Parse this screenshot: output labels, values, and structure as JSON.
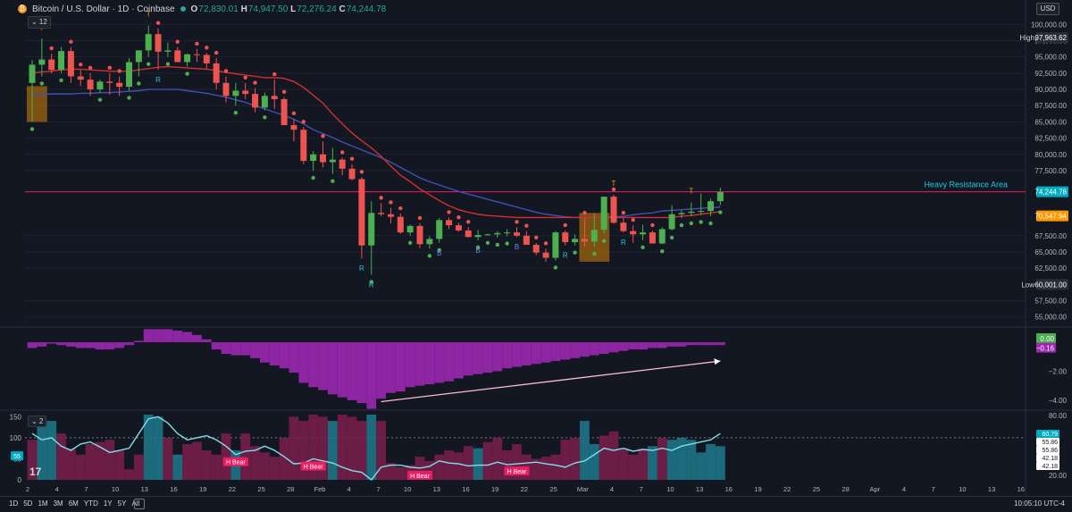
{
  "header": {
    "symbol": "Bitcoin / U.S. Dollar · 1D · Coinbase",
    "open_label": "O",
    "open": "72,830.01",
    "high_label": "H",
    "high": "74,947.50",
    "low_label": "L",
    "low": "72,276.24",
    "close_label": "C",
    "close": "74,244.78",
    "coin_glyph": "₿"
  },
  "badge_interval": "⌄ 12",
  "currency": "USD",
  "colors": {
    "bg": "#131722",
    "up": "#4caf50",
    "down": "#ef5350",
    "teal": "#26c6da",
    "orange": "#ff9800",
    "ema": "#d32f2f",
    "sma": "#3f51b5",
    "hist": "#9c27b0",
    "pink": "#e91e63",
    "grid": "#1f2330"
  },
  "chart_data": [
    {
      "type": "candlestick",
      "title": "Bitcoin / U.S. Dollar · 1D · Coinbase",
      "ylim": [
        54000,
        101000
      ],
      "y_ticks": [
        "100,000.00",
        "97,500.00",
        "95,000.00",
        "92,500.00",
        "90,000.00",
        "87,500.00",
        "85,000.00",
        "82,500.00",
        "80,000.00",
        "77,500.00",
        "67,500.00",
        "65,000.00",
        "62,500.00",
        "57,500.00",
        "55,000.00"
      ],
      "x_ticks": [
        "2",
        "4",
        "7",
        "10",
        "13",
        "16",
        "19",
        "22",
        "25",
        "28",
        "Feb",
        "4",
        "7",
        "10",
        "13",
        "16",
        "19",
        "22",
        "25",
        "Mar",
        "4",
        "7",
        "10",
        "13",
        "16",
        "19",
        "22",
        "25",
        "28",
        "Apr",
        "4",
        "7",
        "10",
        "13",
        "16"
      ],
      "candles_ohlc": [
        [
          91000,
          94500,
          85000,
          93800
        ],
        [
          93800,
          97800,
          92000,
          94600
        ],
        [
          94600,
          95500,
          92500,
          93000
        ],
        [
          93000,
          96500,
          92500,
          95900
        ],
        [
          95900,
          96500,
          91000,
          92000
        ],
        [
          92000,
          93000,
          90500,
          91500
        ],
        [
          91500,
          92500,
          89000,
          90000
        ],
        [
          90000,
          91500,
          89500,
          91200
        ],
        [
          91200,
          92500,
          89200,
          91000
        ],
        [
          91000,
          92000,
          89000,
          90400
        ],
        [
          90400,
          94800,
          89800,
          94200
        ],
        [
          94200,
          96000,
          92000,
          96000
        ],
        [
          96000,
          99800,
          95000,
          98500
        ],
        [
          98500,
          99400,
          93000,
          95800
        ],
        [
          95800,
          97200,
          95000,
          96000
        ],
        [
          96000,
          96500,
          94500,
          94200
        ],
        [
          94200,
          95500,
          93500,
          95400
        ],
        [
          95400,
          96200,
          94200,
          95300
        ],
        [
          95300,
          95600,
          93200,
          94000
        ],
        [
          94000,
          94800,
          90000,
          91000
        ],
        [
          91000,
          92000,
          88000,
          89000
        ],
        [
          89000,
          91000,
          87500,
          89800
        ],
        [
          89800,
          91000,
          88500,
          89300
        ],
        [
          89300,
          90200,
          86500,
          87200
        ],
        [
          87200,
          89500,
          86800,
          89000
        ],
        [
          89000,
          91500,
          87000,
          88500
        ],
        [
          88500,
          88800,
          84500,
          84500
        ],
        [
          84500,
          85500,
          82000,
          83800
        ],
        [
          83800,
          84200,
          78500,
          79000
        ],
        [
          79000,
          80500,
          77500,
          80000
        ],
        [
          80000,
          82000,
          78000,
          78800
        ],
        [
          78800,
          81000,
          77000,
          79200
        ],
        [
          79200,
          79500,
          76800,
          77800
        ],
        [
          77800,
          78500,
          76000,
          76200
        ],
        [
          76200,
          76500,
          64000,
          66000
        ],
        [
          66000,
          72800,
          61500,
          71000
        ],
        [
          71000,
          72500,
          70500,
          70800
        ],
        [
          70800,
          71800,
          69400,
          70400
        ],
        [
          70400,
          70900,
          67800,
          68000
        ],
        [
          68000,
          69200,
          67500,
          69000
        ],
        [
          69000,
          69400,
          65600,
          66200
        ],
        [
          66200,
          67400,
          65500,
          67000
        ],
        [
          67000,
          70200,
          66400,
          69900
        ],
        [
          69900,
          70300,
          68500,
          69100
        ],
        [
          69100,
          69500,
          68100,
          68300
        ],
        [
          68300,
          68800,
          67200,
          67300
        ],
        [
          67300,
          68400,
          66800,
          67600
        ],
        [
          67600,
          67800,
          67500,
          67700
        ],
        [
          67700,
          68200,
          67200,
          67900
        ],
        [
          67900,
          68500,
          67400,
          68000
        ],
        [
          68000,
          68800,
          67300,
          67500
        ],
        [
          67500,
          68200,
          66900,
          66100
        ],
        [
          66100,
          66400,
          64500,
          64900
        ],
        [
          64900,
          65500,
          63500,
          64100
        ],
        [
          64100,
          68200,
          63700,
          68000
        ],
        [
          68000,
          68300,
          66000,
          66500
        ],
        [
          66500,
          67700,
          66000,
          67000
        ],
        [
          67000,
          70200,
          65800,
          66600
        ],
        [
          66600,
          70900,
          65800,
          68400
        ],
        [
          68400,
          72300,
          67800,
          73500
        ],
        [
          73500,
          73800,
          69300,
          69500
        ],
        [
          69500,
          70200,
          68000,
          68200
        ],
        [
          68200,
          69100,
          66400,
          67700
        ],
        [
          67700,
          69200,
          66800,
          68000
        ],
        [
          68000,
          68300,
          66300,
          66300
        ],
        [
          66300,
          68800,
          66200,
          68500
        ],
        [
          68500,
          72200,
          68300,
          70800
        ],
        [
          70800,
          71400,
          70200,
          71000
        ],
        [
          71000,
          72600,
          70500,
          71200
        ],
        [
          71200,
          74000,
          70700,
          71300
        ],
        [
          71300,
          73200,
          70500,
          72800
        ],
        [
          72800,
          74900,
          72200,
          74200
        ]
      ],
      "ema_line": [
        92500,
        92700,
        92800,
        93000,
        93100,
        93100,
        93000,
        92900,
        92800,
        92800,
        92800,
        93000,
        93200,
        93400,
        93500,
        93400,
        93300,
        93200,
        93100,
        92900,
        92600,
        92400,
        92200,
        92000,
        91800,
        91800,
        91700,
        91200,
        90300,
        89100,
        87900,
        86200,
        84700,
        83300,
        82100,
        81000,
        79700,
        78200,
        76800,
        75800,
        74700,
        73800,
        72900,
        72100,
        71500,
        71100,
        70800,
        70600,
        70500,
        70400,
        70300,
        70300,
        70300,
        70300,
        70300,
        70300,
        70300,
        70300,
        70300,
        70300,
        70300,
        70300,
        70300,
        70300,
        70300,
        70300,
        70300,
        70500,
        70600,
        70800,
        71000,
        71200
      ],
      "sma_line": [
        89200,
        89200,
        89300,
        89300,
        89300,
        89400,
        89400,
        89500,
        89500,
        89600,
        89700,
        89800,
        90000,
        90000,
        90000,
        90000,
        89800,
        89600,
        89400,
        89100,
        88800,
        88400,
        88000,
        87500,
        87000,
        86500,
        86000,
        85400,
        84700,
        83800,
        83200,
        82600,
        81900,
        81300,
        80700,
        80100,
        79500,
        78800,
        78000,
        77200,
        76400,
        75800,
        75300,
        74800,
        74300,
        73900,
        73500,
        73100,
        72700,
        72300,
        71900,
        71500,
        71100,
        70800,
        70600,
        70400,
        70300,
        70300,
        70300,
        70400,
        70400,
        70500,
        70700,
        70900,
        71000,
        71300,
        71400,
        71500,
        71600,
        71700,
        71800,
        71900
      ],
      "markers_T": [
        1,
        12,
        60,
        68
      ],
      "markers_R": [
        13,
        34,
        35,
        55,
        61
      ],
      "markers_B": [
        42,
        46,
        50
      ],
      "orange_boxes": [
        [
          0,
          1,
          85000,
          90500
        ],
        [
          57,
          59,
          63500,
          71000
        ]
      ],
      "resistance_level": 74244.78,
      "resistance_label": "Heavy Resistance Area",
      "price_tags": [
        {
          "label": "High",
          "value": "97,963.62",
          "price": 97963.62
        },
        {
          "label": "",
          "value": "74,244.78",
          "price": 74244.78
        },
        {
          "label": "",
          "value": "70,547.94",
          "price": 70547.94
        },
        {
          "label": "Low",
          "value": "60,001.00",
          "price": 60001.0
        }
      ]
    },
    {
      "type": "bar",
      "title": "",
      "ylim": [
        -4.5,
        0.8
      ],
      "y_ticks": [
        "−2.00",
        "−4.00"
      ],
      "values": [
        -0.4,
        -0.3,
        -0.1,
        -0.2,
        -0.3,
        -0.4,
        -0.4,
        -0.5,
        -0.5,
        -0.4,
        -0.2,
        0.1,
        0.9,
        0.9,
        0.9,
        0.8,
        0.7,
        0.5,
        0.2,
        -0.5,
        -0.8,
        -0.9,
        -0.9,
        -1.1,
        -1.4,
        -1.6,
        -1.8,
        -2.1,
        -2.8,
        -3.1,
        -3.3,
        -3.6,
        -3.8,
        -4.0,
        -4.2,
        -4.6,
        -3.9,
        -3.5,
        -3.4,
        -3.1,
        -3.0,
        -2.9,
        -2.8,
        -2.7,
        -2.5,
        -2.3,
        -2.2,
        -2.1,
        -2.0,
        -1.8,
        -1.7,
        -1.6,
        -1.5,
        -1.4,
        -1.3,
        -1.2,
        -1.1,
        -1.0,
        -0.9,
        -0.8,
        -0.7,
        -0.6,
        -0.5,
        -0.5,
        -0.4,
        -0.4,
        -0.3,
        -0.3,
        -0.2,
        -0.2,
        -0.2,
        -0.2
      ],
      "tags": [
        {
          "value": "0.00",
          "y": 0.0
        },
        {
          "value": "−0.16",
          "y": -0.16
        }
      ],
      "trend_line": {
        "from": [
          36,
          -4.1
        ],
        "to": [
          71,
          -1.3
        ]
      }
    },
    {
      "type": "bar",
      "title": "",
      "ylim": [
        0,
        155
      ],
      "y_ticks": [
        "150",
        "100",
        "50",
        "0"
      ],
      "right_ticks": [
        "80.00",
        "20.00"
      ],
      "values": [
        95,
        130,
        140,
        110,
        75,
        60,
        85,
        90,
        95,
        70,
        25,
        60,
        155,
        150,
        100,
        60,
        85,
        90,
        70,
        60,
        110,
        70,
        110,
        80,
        65,
        55,
        100,
        150,
        140,
        155,
        150,
        140,
        155,
        150,
        140,
        155,
        140,
        40,
        30,
        35,
        55,
        45,
        60,
        70,
        65,
        80,
        75,
        90,
        100,
        70,
        85,
        60,
        50,
        55,
        60,
        95,
        100,
        140,
        85,
        105,
        115,
        75,
        60,
        75,
        80,
        100,
        95,
        100,
        95,
        65,
        85,
        80
      ],
      "teal_bars": [
        1,
        2,
        12,
        13,
        15,
        21,
        31,
        35,
        46,
        57,
        58,
        64,
        66,
        67,
        68,
        69,
        70,
        71
      ],
      "line_values": [
        110,
        95,
        100,
        80,
        70,
        85,
        90,
        78,
        65,
        70,
        75,
        110,
        145,
        150,
        135,
        110,
        95,
        100,
        105,
        95,
        80,
        60,
        68,
        70,
        80,
        70,
        55,
        38,
        40,
        50,
        45,
        40,
        30,
        22,
        18,
        0,
        30,
        35,
        35,
        30,
        28,
        32,
        45,
        40,
        38,
        33,
        35,
        35,
        42,
        36,
        38,
        40,
        42,
        38,
        35,
        30,
        40,
        45,
        60,
        75,
        70,
        75,
        68,
        72,
        70,
        75,
        70,
        80,
        85,
        90,
        95,
        110
      ],
      "h_bear_labels": [
        {
          "text": "H Bear",
          "i": 21
        },
        {
          "text": "H Bear",
          "i": 29
        },
        {
          "text": "H Bear",
          "i": 40
        },
        {
          "text": "H Bear",
          "i": 50
        }
      ],
      "right_tags": [
        "60.79",
        "55.86",
        "55.86",
        "42.18",
        "42.18"
      ],
      "left_tag": "55"
    }
  ],
  "bottom_bar": {
    "timeframes": [
      "1D",
      "5D",
      "1M",
      "3M",
      "6M",
      "YTD",
      "1Y",
      "5Y",
      "All"
    ],
    "clock": "10:05:10 UTC-4"
  },
  "panel2_label": "⌄ 2",
  "logo_text": "17"
}
